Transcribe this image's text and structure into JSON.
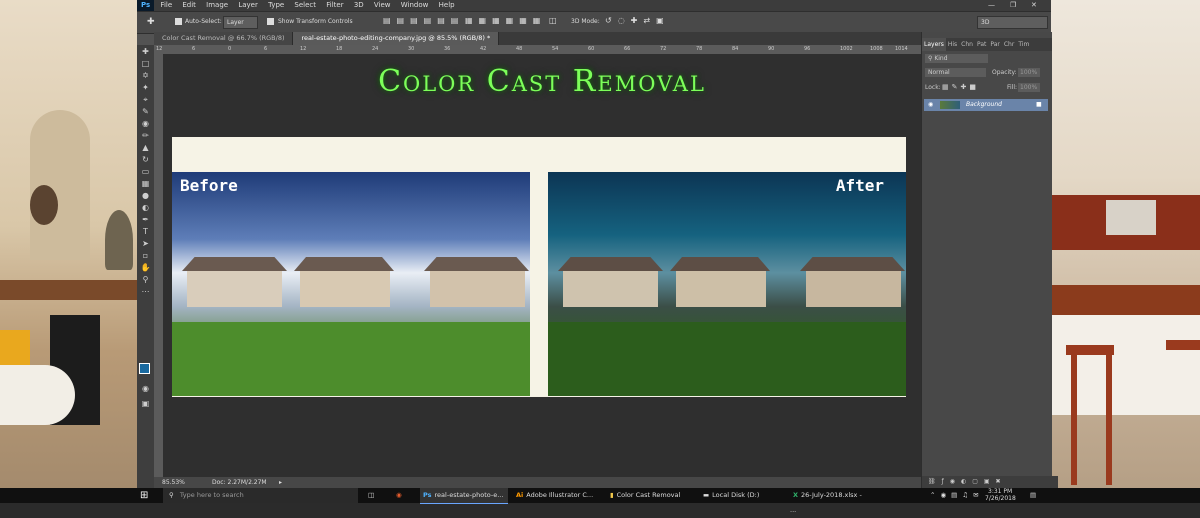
{
  "menubar": {
    "app_logo": "Ps",
    "items": [
      "File",
      "Edit",
      "Image",
      "Layer",
      "Type",
      "Select",
      "Filter",
      "3D",
      "View",
      "Window",
      "Help"
    ]
  },
  "options_bar": {
    "auto_select_label": "Auto-Select:",
    "auto_select_value": "Layer",
    "show_transform_label": "Show Transform Controls",
    "mode_3d_label": "3D Mode:",
    "workspace_value": "3D"
  },
  "tabs": [
    {
      "label": "Color Cast Removal @ 66.7% (RGB/8)",
      "active": false
    },
    {
      "label": "real-estate-photo-editing-company.jpg @ 85.5% (RGB/8) *",
      "active": true
    }
  ],
  "ruler_ticks": [
    "12",
    "6",
    "0",
    "6",
    "12",
    "18",
    "24",
    "30",
    "36",
    "42",
    "48",
    "54",
    "60",
    "66",
    "72",
    "78",
    "84",
    "90",
    "96",
    "1002",
    "1008",
    "1014",
    "1020"
  ],
  "artwork": {
    "title": "Color Cast Removal",
    "before_label": "Before",
    "after_label": "After",
    "title_color": "#7dff5a"
  },
  "statusbar": {
    "zoom": "85.53%",
    "doc": "Doc: 2.27M/2.27M"
  },
  "panels": {
    "tabs": [
      "Layers",
      "His",
      "Chn",
      "Pat",
      "Par",
      "Chr",
      "Tim"
    ],
    "kind_label": "Kind",
    "blend_mode": "Normal",
    "opacity_label": "Opacity:",
    "opacity_value": "100%",
    "lock_label": "Lock:",
    "fill_label": "Fill:",
    "fill_value": "100%",
    "layer_name": "Background"
  },
  "taskbar": {
    "search_placeholder": "Type here to search",
    "apps": [
      "real-estate-photo-e...",
      "Adobe Illustrator C...",
      "Color Cast Removal",
      "Local Disk (D:)",
      "26-July-2018.xlsx - ..."
    ],
    "time": "3:31 PM",
    "date": "7/26/2018"
  }
}
